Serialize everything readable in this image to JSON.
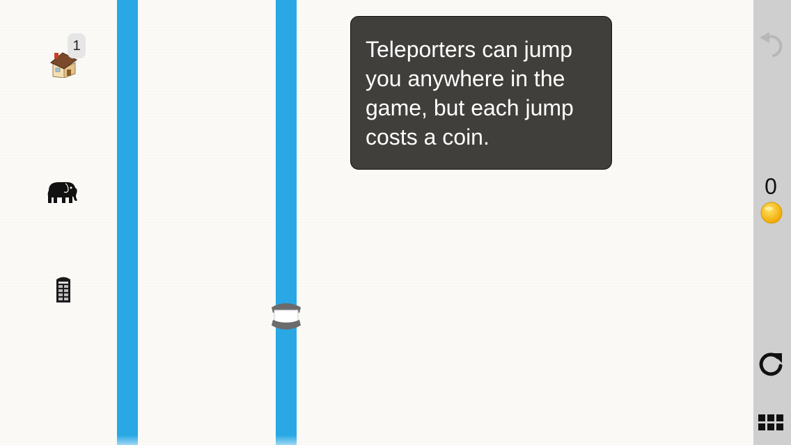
{
  "level_icons": [
    {
      "name": "house",
      "badge": "1"
    },
    {
      "name": "elephant"
    },
    {
      "name": "phone-box"
    }
  ],
  "tooltip": {
    "text": "Teleporters can jump you anywhere in the game, but each jump costs a coin."
  },
  "sidebar": {
    "coin_count": "0",
    "icons": [
      "undo-icon",
      "coin-icon",
      "restart-icon",
      "menu-grid-icon"
    ]
  },
  "colors": {
    "track": "#29a8e5",
    "tooltip_bg": "#403f3b",
    "sidebar_bg": "#cfcfcf",
    "coin": "#f7b500"
  }
}
